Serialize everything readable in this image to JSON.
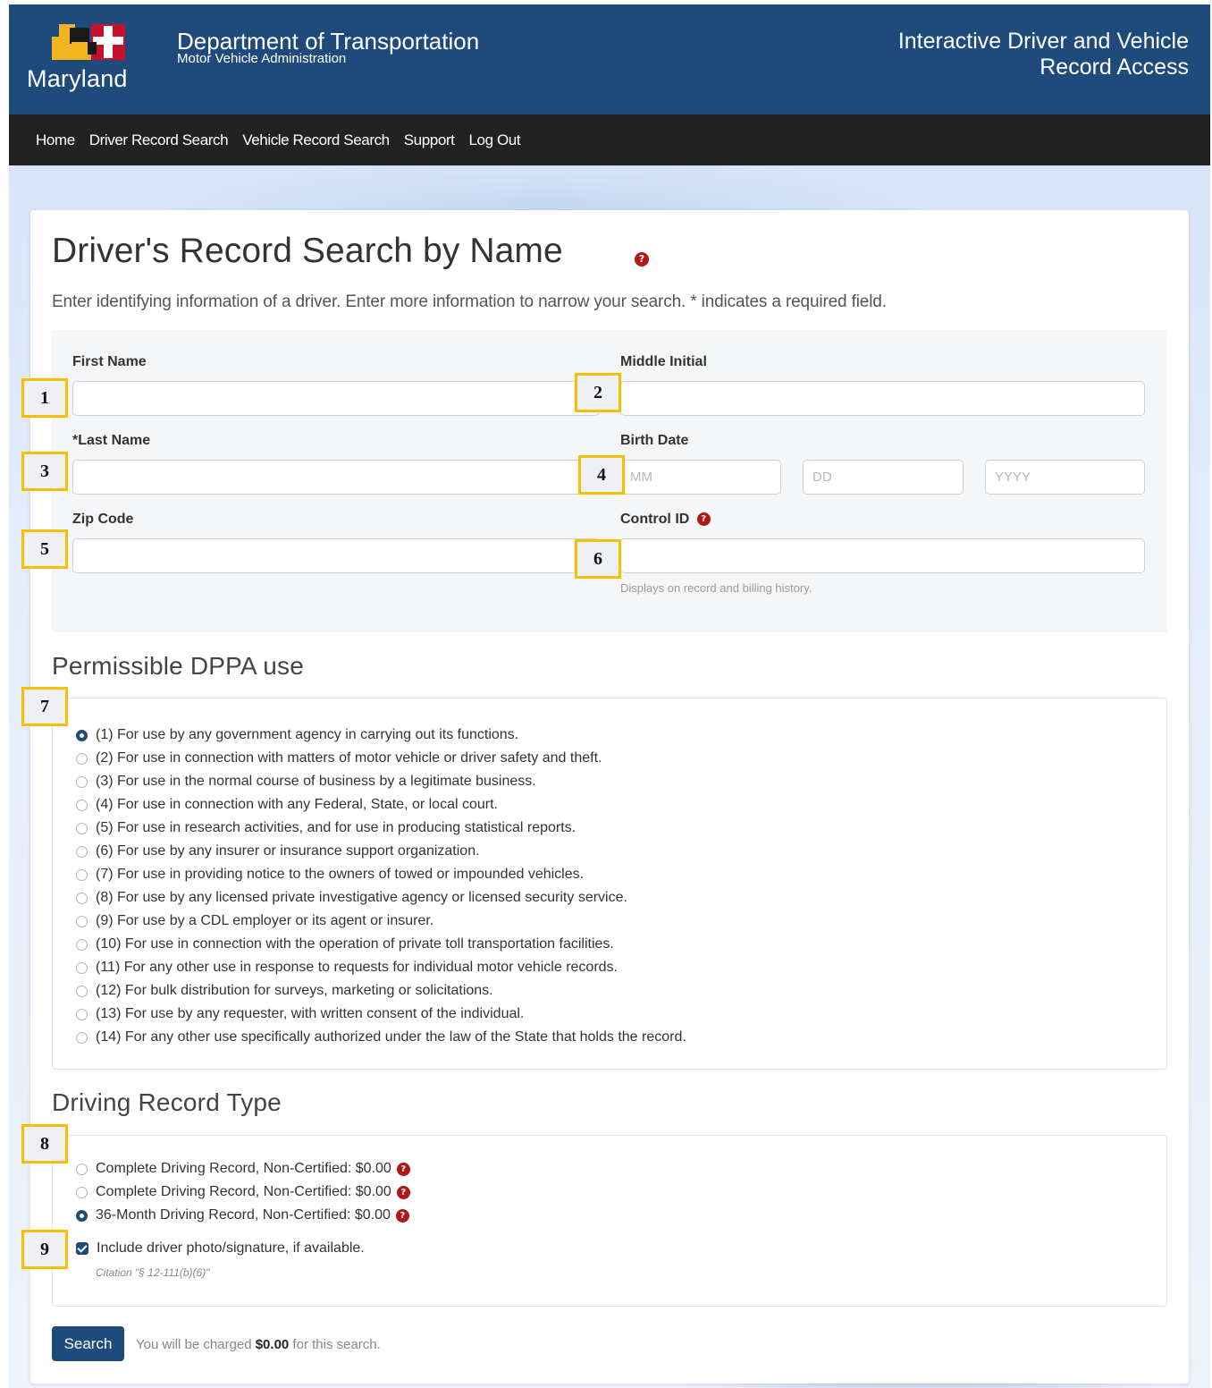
{
  "header": {
    "logo_text": "Maryland",
    "department_title": "Department of Transportation",
    "department_subtitle": "Motor Vehicle Administration",
    "app_title_line1": "Interactive Driver and Vehicle",
    "app_title_line2": "Record Access"
  },
  "nav": {
    "items": [
      "Home",
      "Driver Record Search",
      "Vehicle Record Search",
      "Support",
      "Log Out"
    ]
  },
  "page": {
    "title": "Driver's Record Search by Name",
    "intro": "Enter identifying information of a driver. Enter more information to narrow your search. * indicates a required field."
  },
  "form": {
    "first_name_label": "First Name",
    "first_name_value": "",
    "middle_initial_label": "Middle Initial",
    "middle_initial_value": "",
    "last_name_label": "*Last Name",
    "last_name_value": "",
    "birth_date_label": "Birth Date",
    "birth_mm_placeholder": "MM",
    "birth_dd_placeholder": "DD",
    "birth_yyyy_placeholder": "YYYY",
    "zip_label": "Zip Code",
    "zip_value": "",
    "control_id_label": "Control ID",
    "control_id_value": "",
    "control_id_hint": "Displays on record and billing history."
  },
  "dppa": {
    "heading": "Permissible DPPA use",
    "selected_index": 0,
    "options": [
      "(1) For use by any government agency in carrying out its functions.",
      "(2) For use in connection with matters of motor vehicle or driver safety and theft.",
      "(3) For use in the normal course of business by a legitimate business.",
      "(4) For use in connection with any Federal, State, or local court.",
      "(5) For use in research activities, and for use in producing statistical reports.",
      "(6) For use by any insurer or insurance support organization.",
      "(7) For use in providing notice to the owners of towed or impounded vehicles.",
      "(8) For use by any licensed private investigative agency or licensed security service.",
      "(9) For use by a CDL employer or its agent or insurer.",
      "(10) For use in connection with the operation of private toll transportation facilities.",
      "(11) For any other use in response to requests for individual motor vehicle records.",
      "(12) For bulk distribution for surveys, marketing or solicitations.",
      "(13) For use by any requester, with written consent of the individual.",
      "(14) For any other use specifically authorized under the law of the State that holds the record."
    ]
  },
  "record_type": {
    "heading": "Driving Record Type",
    "selected_index": 2,
    "options": [
      "Complete Driving Record, Non-Certified: $0.00",
      "Complete Driving Record, Non-Certified: $0.00",
      "36-Month Driving Record, Non-Certified: $0.00"
    ],
    "photo_checkbox_label": "Include driver photo/signature, if available.",
    "photo_checkbox_checked": true,
    "citation": "Citation \"§ 12-111(b)(6)\""
  },
  "footer": {
    "search_label": "Search",
    "charge_prefix": "You will be charged ",
    "charge_amount": "$0.00",
    "charge_suffix": " for this search."
  },
  "markers": [
    "1",
    "2",
    "3",
    "4",
    "5",
    "6",
    "7",
    "8",
    "9"
  ],
  "colors": {
    "header_bg": "#1f4b7c",
    "nav_bg": "#222222",
    "help_icon": "#b01818",
    "marker_border": "#f6c000"
  }
}
